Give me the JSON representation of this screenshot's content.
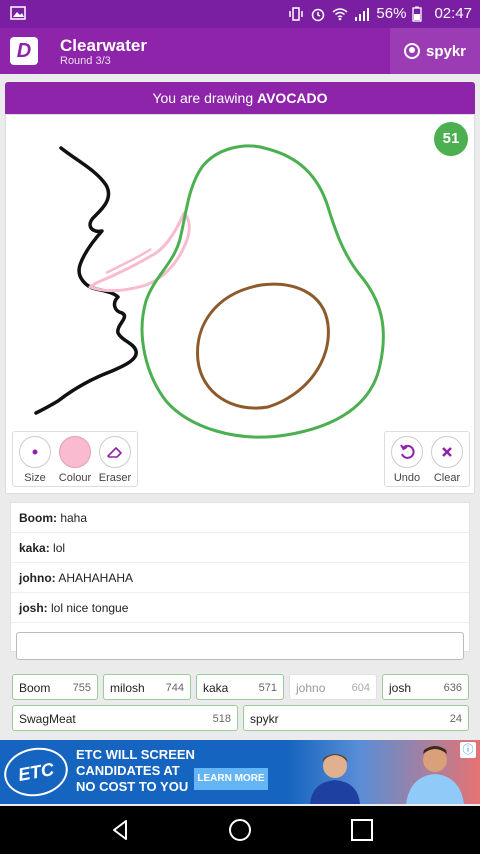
{
  "status": {
    "battery": "56%",
    "time": "02:47"
  },
  "header": {
    "logo": "D",
    "title": "Clearwater",
    "round": "Round 3/3",
    "username": "spykr"
  },
  "banner": {
    "prefix": "You are drawing ",
    "word": "AVOCADO"
  },
  "canvas": {
    "timer": "51"
  },
  "tools": {
    "size": "Size",
    "colour": "Colour",
    "eraser": "Eraser",
    "undo": "Undo",
    "clear": "Clear",
    "colour_value": "#f8bbd0"
  },
  "chat": [
    {
      "user": "Boom:",
      "msg": " haha"
    },
    {
      "user": "kaka:",
      "msg": " lol"
    },
    {
      "user": "johno:",
      "msg": " AHAHAHAHA"
    },
    {
      "user": "josh:",
      "msg": " lol nice tongue"
    }
  ],
  "scores": [
    {
      "name": "Boom",
      "points": "755"
    },
    {
      "name": "milosh",
      "points": "744"
    },
    {
      "name": "kaka",
      "points": "571"
    },
    {
      "name": "johno",
      "points": "604"
    },
    {
      "name": "josh",
      "points": "636"
    },
    {
      "name": "SwagMeat",
      "points": "518"
    },
    {
      "name": "spykr",
      "points": "24"
    }
  ],
  "ad": {
    "logo": "ETC",
    "line1": "ETC WILL SCREEN",
    "line2": "CANDIDATES AT",
    "line3": "NO COST TO YOU",
    "button": "LEARN MORE"
  },
  "colors": {
    "accent": "#8e24aa",
    "timer": "#4caf50"
  }
}
